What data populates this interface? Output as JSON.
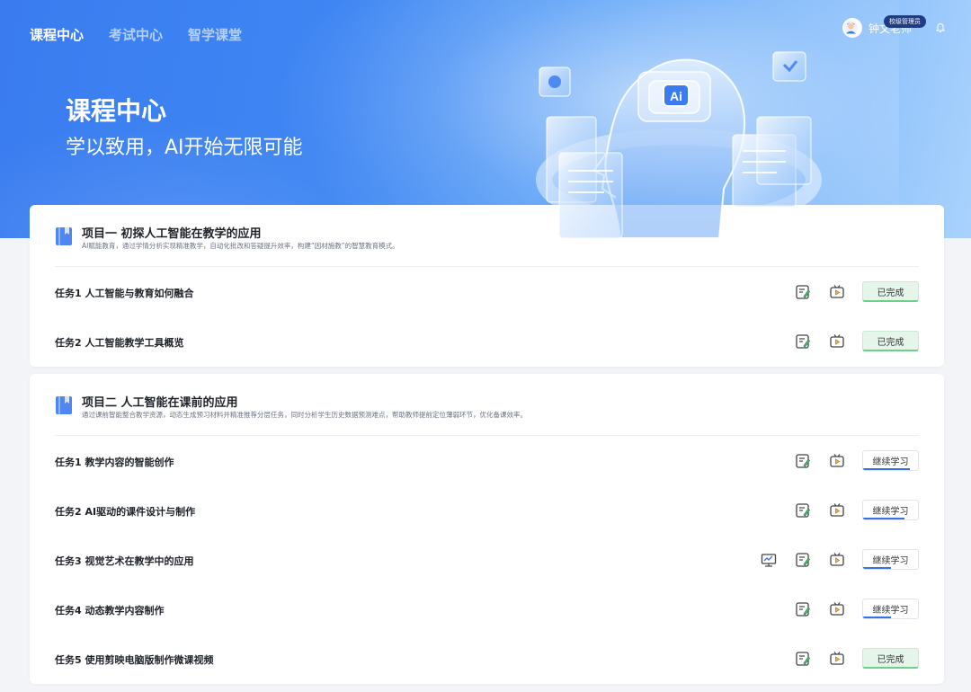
{
  "nav": {
    "items": [
      {
        "label": "课程中心",
        "active": true
      },
      {
        "label": "考试中心",
        "active": false
      },
      {
        "label": "智学课堂",
        "active": false
      }
    ]
  },
  "user": {
    "name": "钟文老师",
    "role": "校级管理员"
  },
  "hero": {
    "title": "课程中心",
    "subtitle": "学以致用，AI开始无限可能",
    "art_label": "Ai"
  },
  "projects": [
    {
      "title": "项目一 初探人工智能在教学的应用",
      "description": "AI赋能教育，通过学情分析实现精准教学，自动化批改和答疑提升效率，构建“因材施教”的智慧教育模式。",
      "tasks": [
        {
          "name": "任务1 人工智能与教育如何融合",
          "status": "已完成",
          "state": "done"
        },
        {
          "name": "任务2 人工智能教学工具概览",
          "status": "已完成",
          "state": "done"
        }
      ]
    },
    {
      "title": "项目二 人工智能在课前的应用",
      "description": "通过课前智能整合教学资源，动态生成预习材料并精准推荐分层任务，同时分析学生历史数据预测难点，帮助教师提前定位薄弱环节，优化备课效率。",
      "tasks": [
        {
          "name": "任务1 教学内容的智能创作",
          "status": "继续学习",
          "state": "continue",
          "progress": 0.85
        },
        {
          "name": "任务2 AI驱动的课件设计与制作",
          "status": "继续学习",
          "state": "continue",
          "progress": 0.75
        },
        {
          "name": "任务3 视觉艺术在教学中的应用",
          "status": "继续学习",
          "state": "continue",
          "progress": 0.5,
          "has_ppt": true
        },
        {
          "name": "任务4 动态教学内容制作",
          "status": "继续学习",
          "state": "continue",
          "progress": 0.5
        },
        {
          "name": "任务5 使用剪映电脑版制作微课视频",
          "status": "已完成",
          "state": "done"
        }
      ]
    }
  ]
}
